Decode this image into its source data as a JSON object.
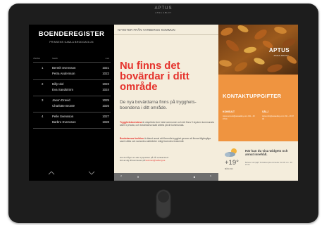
{
  "device": {
    "brand": "APTUS",
    "brand_sub": "ASSA ABLOY"
  },
  "register": {
    "title": "BOENDEREGISTER",
    "address": "PRINSENS GAMLA BRODGATA 25",
    "columns": [
      "VÅNING",
      "NAMN",
      "LGH"
    ],
    "groups": [
      {
        "rows": [
          {
            "floor": "1",
            "name": "Bernth Svensson",
            "apt": "1021"
          },
          {
            "floor": "",
            "name": "Petra Andersson",
            "apt": "1022"
          }
        ]
      },
      {
        "rows": [
          {
            "floor": "2",
            "name": "Billy Idol",
            "apt": "1023"
          },
          {
            "floor": "",
            "name": "Eva Sandström",
            "apt": "1024"
          }
        ]
      },
      {
        "rows": [
          {
            "floor": "3",
            "name": "Jason Dravid",
            "apt": "1025"
          },
          {
            "floor": "",
            "name": "Charlotte Brontë",
            "apt": "1026"
          }
        ]
      },
      {
        "rows": [
          {
            "floor": "4",
            "name": "Pelle Svensson",
            "apt": "1027"
          },
          {
            "floor": "",
            "name": "Barbro Svensson",
            "apt": "1028"
          }
        ]
      }
    ]
  },
  "news": {
    "header": "NYHETER FRÅN VARBERGS KOMMUN",
    "headline": "Nu finns det bovärdar i ditt område",
    "lede": "De nya bovärdarna finns på trygghets-boendena i ditt område.",
    "para1_bold": "Trygghetsboendena",
    "para1_text": "är utspridda över hela kommunen och det finns 9 stycken kommunala samt 4 privata, och bovärdarna skall arbeta på de kommunala.",
    "para2_bold": "Bovärdarnas funktion",
    "para2_text": "är bland annat att förmedla trygghet genom att finnas tillgängliga samt stötta och samordna aktiviteter enligt boendes önskemål.",
    "contact_line1": "Har du frågor om eller synpunkter på vår verksamhet?",
    "contact_line2": "Hör av dig till kommunen på",
    "contact_link": "kommun@varberg.se"
  },
  "news_nav": {
    "prev": "‹",
    "pause": "II",
    "doc": "■",
    "next": "›"
  },
  "right": {
    "logo": "APTUS",
    "logo_sub": "ASSA ABLOY",
    "contact_title": "KONTAKTUPPGIFTER",
    "konsult_label": "KONSULT",
    "konsult_text": "Aptus.konsult@aswaddey.com 031 - 48 97 00",
    "salj_label": "SÄLJ",
    "salj_text": "Aptus.info@aswaddey.com 031 - 48 97 00",
    "temp": "+19°",
    "temp_date": "MÅN 2/14",
    "weather_title": "Här kan du visa widgets och annat innehåll.",
    "weather_text": "Behöver du hjälp? Kontakta Aptus konsulter via 031 xxx - 48 97 00."
  },
  "colors": {
    "accent_red": "#e5322c",
    "contact_orange": "#ef9440",
    "panel_cream": "#f4eddc"
  }
}
